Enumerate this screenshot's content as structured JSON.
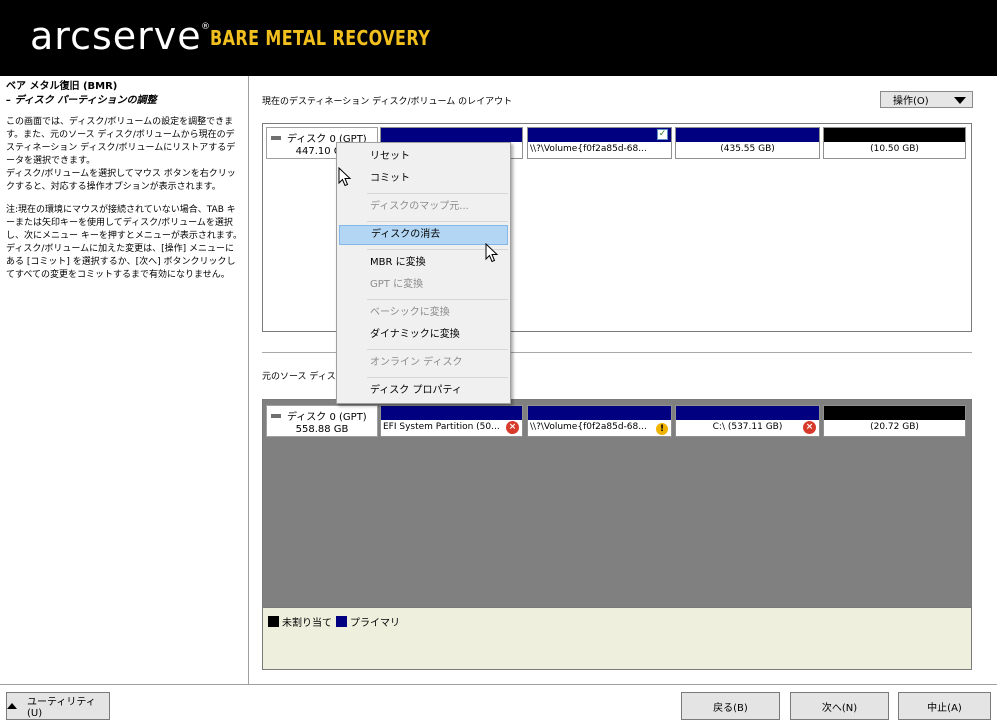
{
  "header": {
    "brand": "arcserve",
    "registered": "®",
    "product": "BARE METAL RECOVERY"
  },
  "left": {
    "title": "ベア メタル復旧 (BMR)",
    "subtitle": "– ディスク パーティションの調整",
    "para1": "この画面では、ディスク/ボリュームの設定を調整できます。また、元のソース ディスク/ボリュームから現在のデスティネーション ディスク/ボリュームにリストアするデータを選択できます。",
    "para2": "ディスク/ボリュームを選択してマウス ボタンを右クリックすると、対応する操作オプションが表示されます。",
    "para3": "注:現在の環境にマウスが接続されていない場合、TAB キーまたは矢印キーを使用してディスク/ボリュームを選択し、次にメニュー キーを押すとメニューが表示されます。ディスク/ボリュームに加えた変更は、[操作] メニューにある [コミット] を選択するか、[次へ] ボタンクリックしてすべての変更をコミットするまで有効になりません。"
  },
  "dest": {
    "label": "現在のデスティネーション ディスク/ボリューム のレイアウト",
    "ops_button": "操作(O)",
    "disk_name": "ディスク 0 (GPT)",
    "disk_size": "447.10 GB",
    "volumes": [
      {
        "text": ""
      },
      {
        "text": "\\\\?\\Volume{f0f2a85d-68..."
      },
      {
        "text": "(435.55 GB)"
      },
      {
        "text": "(10.50 GB)"
      }
    ],
    "check_glyph": "✓"
  },
  "src": {
    "label": "元のソース ディスク",
    "disk_name": "ディスク 0 (GPT)",
    "disk_size": "558.88 GB",
    "volumes": [
      {
        "text": "EFI System Partition (50..."
      },
      {
        "text": "\\\\?\\Volume{f0f2a85d-68..."
      },
      {
        "text": "C:\\ (537.11 GB)"
      },
      {
        "text": "(20.72 GB)"
      }
    ],
    "err_glyph": "×",
    "warn_glyph": "!"
  },
  "legend": {
    "unallocated": "未割り当て",
    "primary": "プライマリ"
  },
  "menu": {
    "reset": "リセット",
    "commit": "コミット",
    "map_disk_from": "ディスクのマップ元...",
    "clean_disk": "ディスクの消去",
    "convert_mbr": "MBR に変換",
    "convert_gpt": "GPT に変換",
    "convert_basic": "ベーシックに変換",
    "convert_dynamic": "ダイナミックに変換",
    "online_disk": "オンライン ディスク",
    "disk_properties": "ディスク プロパティ"
  },
  "footer": {
    "utility": "ユーティリティ(U)",
    "back": "戻る(B)",
    "next": "次へ(N)",
    "abort": "中止(A)"
  },
  "colors": {
    "primary": "#000080",
    "unallocated": "#000000",
    "header": "#000000",
    "product": "#f2c01e",
    "menu_highlight": "#b2d6f3"
  }
}
